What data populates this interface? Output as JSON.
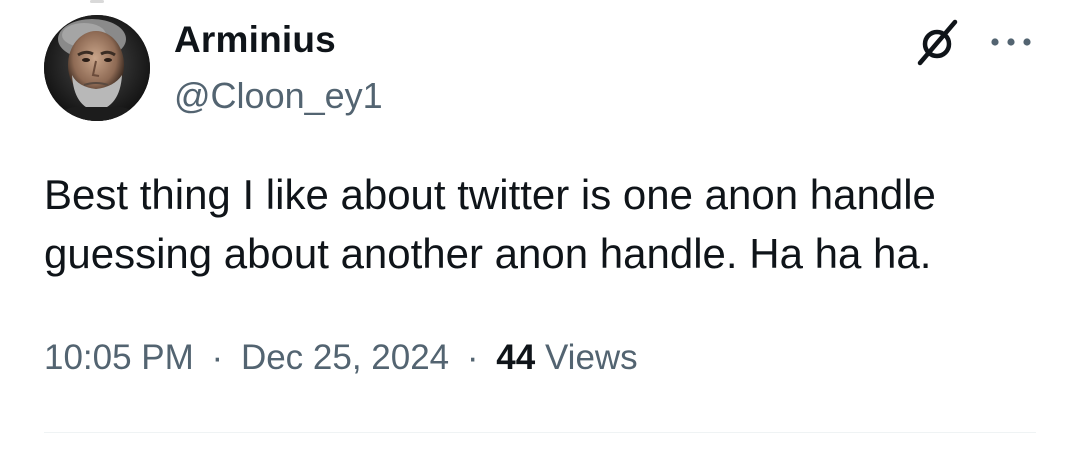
{
  "author": {
    "display_name": "Arminius",
    "handle": "@Cloon_ey1"
  },
  "tweet": {
    "line1": "Best thing I like about twitter is one anon handle",
    "line2": "guessing about another anon handle. Ha ha ha."
  },
  "meta": {
    "time": "10:05 PM",
    "separator": "·",
    "date": "Dec 25, 2024",
    "views_count": "44",
    "views_label": "Views"
  },
  "icons": {
    "grok": "grok-icon",
    "more": "more-options-icon"
  },
  "colors": {
    "text": "#0f1419",
    "secondary": "#536471",
    "divider": "#eff3f4",
    "background": "#ffffff"
  }
}
